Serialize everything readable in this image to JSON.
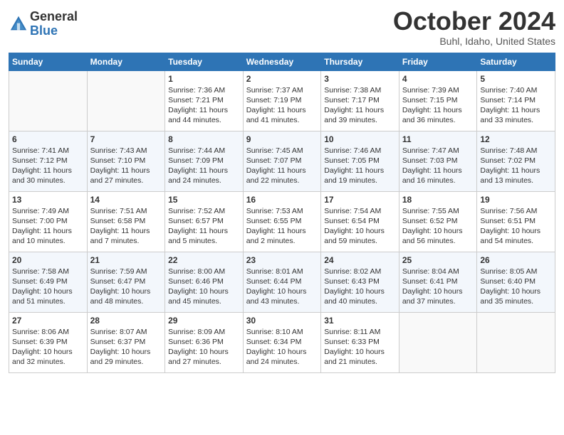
{
  "logo": {
    "general": "General",
    "blue": "Blue"
  },
  "title": "October 2024",
  "location": "Buhl, Idaho, United States",
  "days_of_week": [
    "Sunday",
    "Monday",
    "Tuesday",
    "Wednesday",
    "Thursday",
    "Friday",
    "Saturday"
  ],
  "weeks": [
    [
      {
        "day": "",
        "info": ""
      },
      {
        "day": "",
        "info": ""
      },
      {
        "day": "1",
        "info": "Sunrise: 7:36 AM\nSunset: 7:21 PM\nDaylight: 11 hours and 44 minutes."
      },
      {
        "day": "2",
        "info": "Sunrise: 7:37 AM\nSunset: 7:19 PM\nDaylight: 11 hours and 41 minutes."
      },
      {
        "day": "3",
        "info": "Sunrise: 7:38 AM\nSunset: 7:17 PM\nDaylight: 11 hours and 39 minutes."
      },
      {
        "day": "4",
        "info": "Sunrise: 7:39 AM\nSunset: 7:15 PM\nDaylight: 11 hours and 36 minutes."
      },
      {
        "day": "5",
        "info": "Sunrise: 7:40 AM\nSunset: 7:14 PM\nDaylight: 11 hours and 33 minutes."
      }
    ],
    [
      {
        "day": "6",
        "info": "Sunrise: 7:41 AM\nSunset: 7:12 PM\nDaylight: 11 hours and 30 minutes."
      },
      {
        "day": "7",
        "info": "Sunrise: 7:43 AM\nSunset: 7:10 PM\nDaylight: 11 hours and 27 minutes."
      },
      {
        "day": "8",
        "info": "Sunrise: 7:44 AM\nSunset: 7:09 PM\nDaylight: 11 hours and 24 minutes."
      },
      {
        "day": "9",
        "info": "Sunrise: 7:45 AM\nSunset: 7:07 PM\nDaylight: 11 hours and 22 minutes."
      },
      {
        "day": "10",
        "info": "Sunrise: 7:46 AM\nSunset: 7:05 PM\nDaylight: 11 hours and 19 minutes."
      },
      {
        "day": "11",
        "info": "Sunrise: 7:47 AM\nSunset: 7:03 PM\nDaylight: 11 hours and 16 minutes."
      },
      {
        "day": "12",
        "info": "Sunrise: 7:48 AM\nSunset: 7:02 PM\nDaylight: 11 hours and 13 minutes."
      }
    ],
    [
      {
        "day": "13",
        "info": "Sunrise: 7:49 AM\nSunset: 7:00 PM\nDaylight: 11 hours and 10 minutes."
      },
      {
        "day": "14",
        "info": "Sunrise: 7:51 AM\nSunset: 6:58 PM\nDaylight: 11 hours and 7 minutes."
      },
      {
        "day": "15",
        "info": "Sunrise: 7:52 AM\nSunset: 6:57 PM\nDaylight: 11 hours and 5 minutes."
      },
      {
        "day": "16",
        "info": "Sunrise: 7:53 AM\nSunset: 6:55 PM\nDaylight: 11 hours and 2 minutes."
      },
      {
        "day": "17",
        "info": "Sunrise: 7:54 AM\nSunset: 6:54 PM\nDaylight: 10 hours and 59 minutes."
      },
      {
        "day": "18",
        "info": "Sunrise: 7:55 AM\nSunset: 6:52 PM\nDaylight: 10 hours and 56 minutes."
      },
      {
        "day": "19",
        "info": "Sunrise: 7:56 AM\nSunset: 6:51 PM\nDaylight: 10 hours and 54 minutes."
      }
    ],
    [
      {
        "day": "20",
        "info": "Sunrise: 7:58 AM\nSunset: 6:49 PM\nDaylight: 10 hours and 51 minutes."
      },
      {
        "day": "21",
        "info": "Sunrise: 7:59 AM\nSunset: 6:47 PM\nDaylight: 10 hours and 48 minutes."
      },
      {
        "day": "22",
        "info": "Sunrise: 8:00 AM\nSunset: 6:46 PM\nDaylight: 10 hours and 45 minutes."
      },
      {
        "day": "23",
        "info": "Sunrise: 8:01 AM\nSunset: 6:44 PM\nDaylight: 10 hours and 43 minutes."
      },
      {
        "day": "24",
        "info": "Sunrise: 8:02 AM\nSunset: 6:43 PM\nDaylight: 10 hours and 40 minutes."
      },
      {
        "day": "25",
        "info": "Sunrise: 8:04 AM\nSunset: 6:41 PM\nDaylight: 10 hours and 37 minutes."
      },
      {
        "day": "26",
        "info": "Sunrise: 8:05 AM\nSunset: 6:40 PM\nDaylight: 10 hours and 35 minutes."
      }
    ],
    [
      {
        "day": "27",
        "info": "Sunrise: 8:06 AM\nSunset: 6:39 PM\nDaylight: 10 hours and 32 minutes."
      },
      {
        "day": "28",
        "info": "Sunrise: 8:07 AM\nSunset: 6:37 PM\nDaylight: 10 hours and 29 minutes."
      },
      {
        "day": "29",
        "info": "Sunrise: 8:09 AM\nSunset: 6:36 PM\nDaylight: 10 hours and 27 minutes."
      },
      {
        "day": "30",
        "info": "Sunrise: 8:10 AM\nSunset: 6:34 PM\nDaylight: 10 hours and 24 minutes."
      },
      {
        "day": "31",
        "info": "Sunrise: 8:11 AM\nSunset: 6:33 PM\nDaylight: 10 hours and 21 minutes."
      },
      {
        "day": "",
        "info": ""
      },
      {
        "day": "",
        "info": ""
      }
    ]
  ]
}
